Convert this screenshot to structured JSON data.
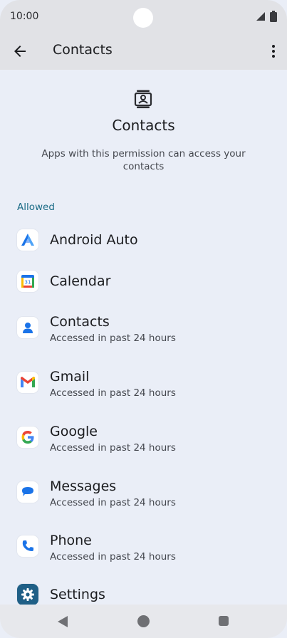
{
  "status_bar": {
    "time": "10:00"
  },
  "app_bar": {
    "title": "Contacts"
  },
  "header": {
    "icon": "contacts-card-icon",
    "title": "Contacts",
    "description": "Apps with this permission can access your contacts"
  },
  "section": {
    "label": "Allowed"
  },
  "apps": [
    {
      "name": "Android Auto",
      "subtitle": "",
      "icon": "android-auto-icon"
    },
    {
      "name": "Calendar",
      "subtitle": "",
      "icon": "calendar-icon"
    },
    {
      "name": "Contacts",
      "subtitle": "Accessed in past 24 hours",
      "icon": "contacts-icon"
    },
    {
      "name": "Gmail",
      "subtitle": "Accessed in past 24 hours",
      "icon": "gmail-icon"
    },
    {
      "name": "Google",
      "subtitle": "Accessed in past 24 hours",
      "icon": "google-icon"
    },
    {
      "name": "Messages",
      "subtitle": "Accessed in past 24 hours",
      "icon": "messages-icon"
    },
    {
      "name": "Phone",
      "subtitle": "Accessed in past 24 hours",
      "icon": "phone-icon"
    },
    {
      "name": "Settings",
      "subtitle": "",
      "icon": "settings-icon"
    }
  ],
  "calendar_day": "31",
  "colors": {
    "background": "#eaeef7",
    "app_bar": "#e1e2e6",
    "section_accent": "#1a6b86"
  }
}
